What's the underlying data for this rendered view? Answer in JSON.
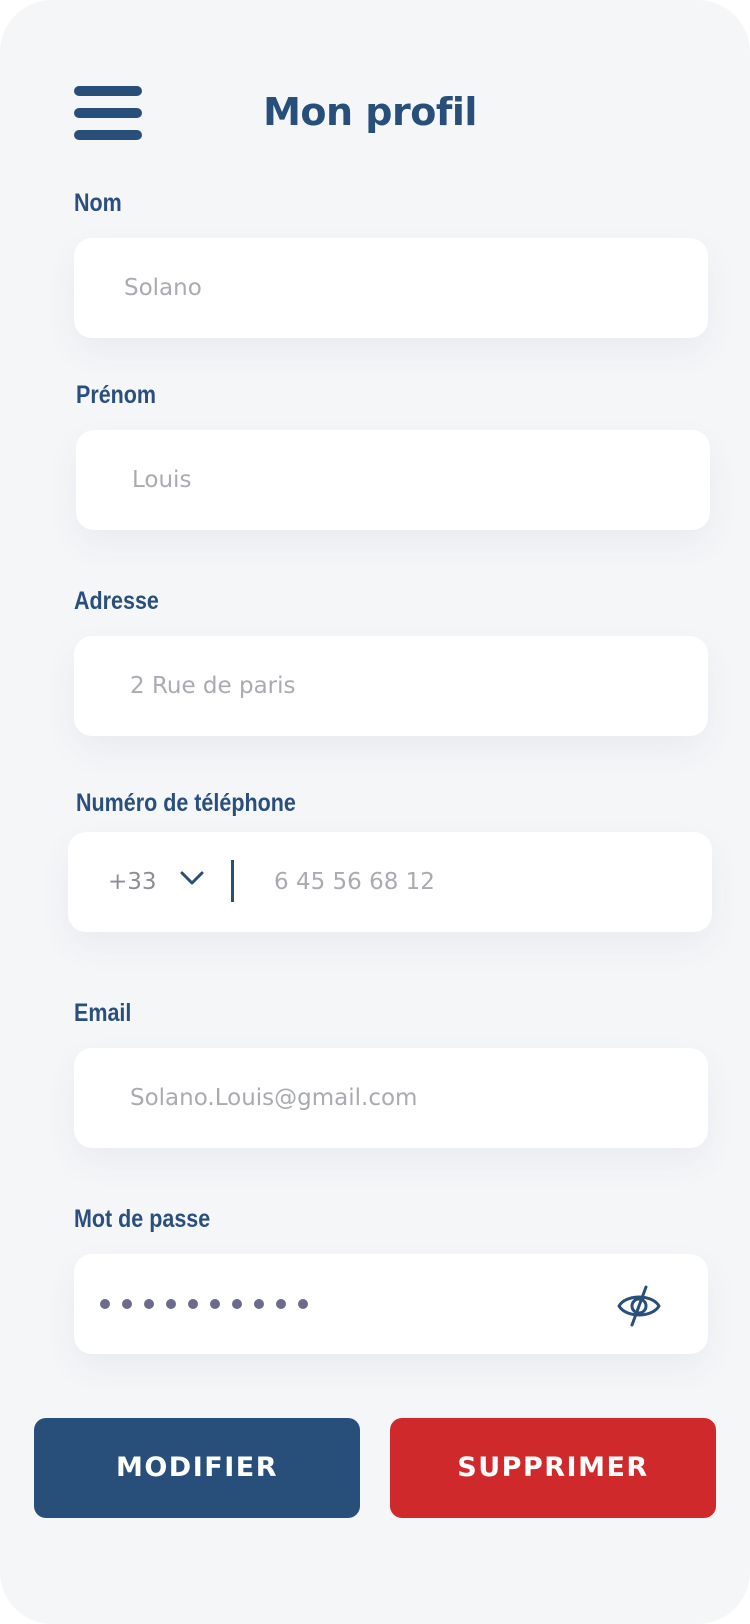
{
  "header": {
    "title": "Mon profil",
    "menu_icon": "hamburger-menu-icon"
  },
  "form": {
    "nom": {
      "label": "Nom",
      "value": "Solano"
    },
    "prenom": {
      "label": "Prénom",
      "value": "Louis"
    },
    "adresse": {
      "label": "Adresse",
      "value": "2 Rue de paris"
    },
    "telephone": {
      "label": "Numéro de téléphone",
      "country_code": "+33",
      "value": "6 45 56 68 12",
      "dropdown_icon": "chevron-down-icon"
    },
    "email": {
      "label": "Email",
      "value": "Solano.Louis@gmail.com"
    },
    "password": {
      "label": "Mot de passe",
      "masked_length": 10,
      "visibility_icon": "eye-slash-icon"
    }
  },
  "actions": {
    "modify_label": "MODIFIER",
    "delete_label": "SUPPRIMER"
  },
  "colors": {
    "primary": "#284f7a",
    "danger": "#d0292b",
    "background": "#f5f6f8",
    "field_background": "#ffffff",
    "value_text": "#a9abb0",
    "password_dots": "#6c6a8d"
  }
}
